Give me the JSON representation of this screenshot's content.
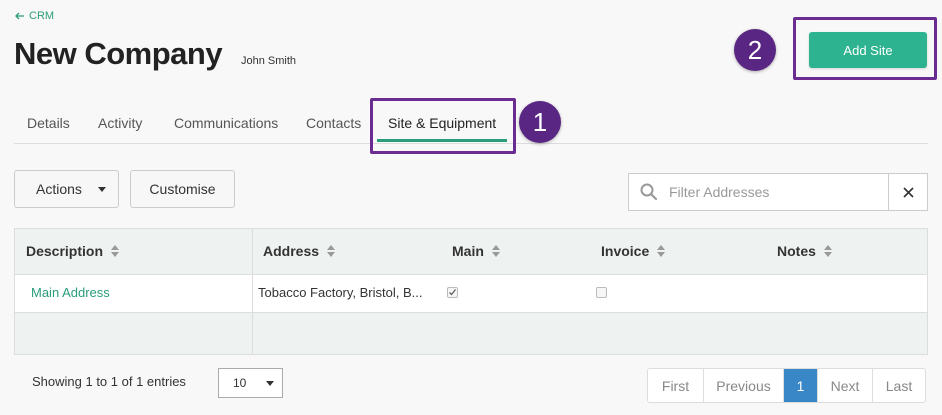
{
  "breadcrumb": {
    "back_label": "CRM"
  },
  "header": {
    "title": "New Company",
    "owner": "John Smith"
  },
  "primary_action": {
    "label": "Add Site"
  },
  "callouts": {
    "step1": "1",
    "step2": "2"
  },
  "tabs": [
    {
      "label": "Details"
    },
    {
      "label": "Activity"
    },
    {
      "label": "Communications"
    },
    {
      "label": "Contacts"
    },
    {
      "label": "Site & Equipment",
      "active": true
    }
  ],
  "toolbar": {
    "actions_label": "Actions",
    "customise_label": "Customise"
  },
  "filter": {
    "placeholder": "Filter Addresses",
    "value": ""
  },
  "table": {
    "columns": [
      "Description",
      "Address",
      "Main",
      "Invoice",
      "Notes"
    ],
    "rows": [
      {
        "description": "Main Address",
        "address": "Tobacco Factory, Bristol, B...",
        "main": true,
        "invoice": false,
        "notes": ""
      }
    ]
  },
  "footer": {
    "showing": "Showing 1 to 1 of 1 entries",
    "page_length": "10",
    "pagination": [
      "First",
      "Previous",
      "1",
      "Next",
      "Last"
    ],
    "current_page": "1"
  },
  "colors": {
    "accent": "#2a9d7a",
    "button": "#2db38f",
    "callout": "#5a2683",
    "page_active": "#3a87c8"
  }
}
